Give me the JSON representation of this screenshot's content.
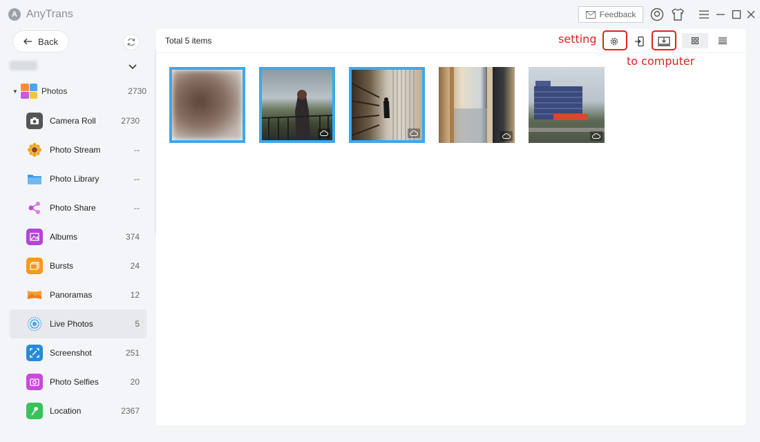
{
  "window": {
    "app_title": "AnyTrans",
    "feedback_label": "Feedback"
  },
  "sidebar": {
    "back_label": "Back",
    "photos_group": {
      "label": "Photos",
      "count": "2730"
    },
    "items": [
      {
        "label": "Camera Roll",
        "count": "2730",
        "icon": "camera-icon",
        "color": "#555555"
      },
      {
        "label": "Photo Stream",
        "count": "--",
        "icon": "sunflower-icon",
        "color": "#f5a623"
      },
      {
        "label": "Photo Library",
        "count": "--",
        "icon": "folder-icon",
        "color": "#3b9ce8"
      },
      {
        "label": "Photo Share",
        "count": "--",
        "icon": "share-icon",
        "color": "#c050d0"
      },
      {
        "label": "Albums",
        "count": "374",
        "icon": "album-icon",
        "color": "#b245d8"
      },
      {
        "label": "Bursts",
        "count": "24",
        "icon": "bursts-icon",
        "color": "#f59a1b"
      },
      {
        "label": "Panoramas",
        "count": "12",
        "icon": "panorama-icon",
        "color": "#f7a032"
      },
      {
        "label": "Live Photos",
        "count": "5",
        "icon": "live-photo-icon",
        "color": "#3ba8f0",
        "active": true
      },
      {
        "label": "Screenshot",
        "count": "251",
        "icon": "screenshot-icon",
        "color": "#2a8ad8"
      },
      {
        "label": "Photo Selfies",
        "count": "20",
        "icon": "selfie-icon",
        "color": "#c94ad8"
      },
      {
        "label": "Location",
        "count": "2367",
        "icon": "location-icon",
        "color": "#3ac25a"
      }
    ]
  },
  "main": {
    "total_label": "Total 5 items",
    "annotations": {
      "setting": "setting",
      "to_computer": "to computer"
    },
    "accent_color": "#3ba8f0",
    "annotation_color": "#e02020"
  }
}
